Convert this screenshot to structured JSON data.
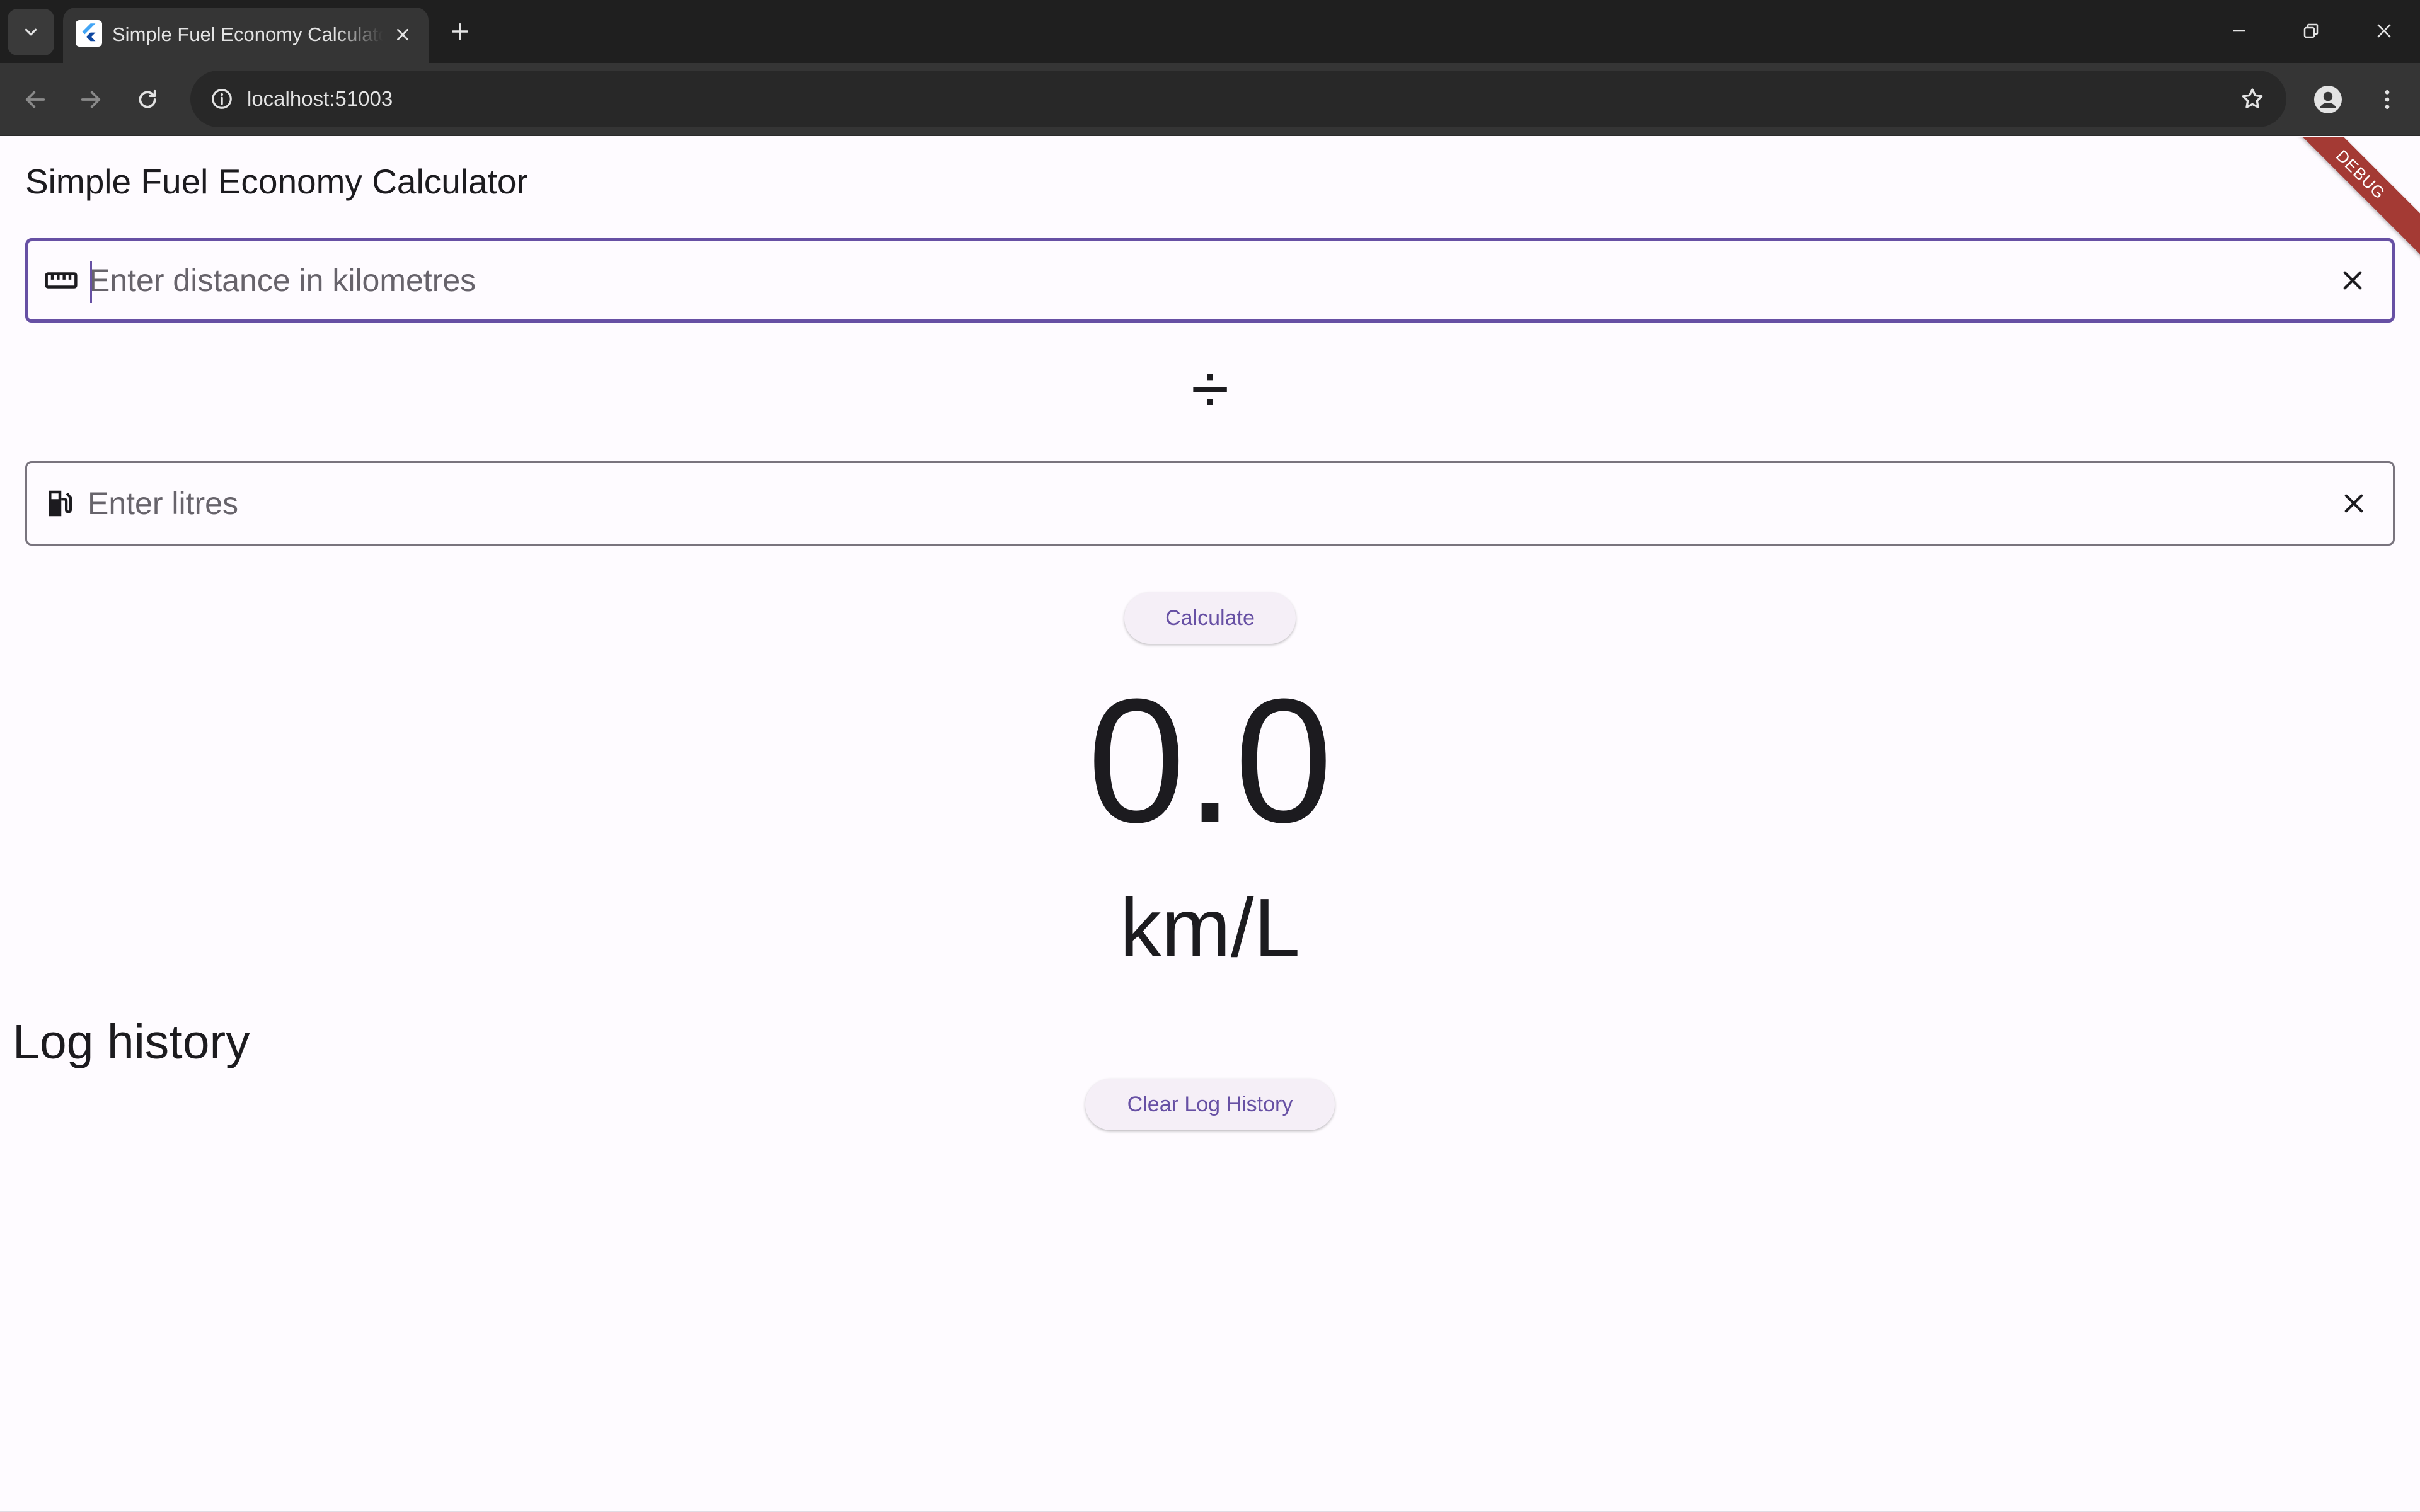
{
  "browser": {
    "tab_title": "Simple Fuel Economy Calculator",
    "url": "localhost:51003"
  },
  "app": {
    "title": "Simple Fuel Economy Calculator",
    "debug_banner": "DEBUG",
    "distance_field": {
      "placeholder": "Enter distance in kilometres",
      "value": "",
      "icon": "ruler-icon"
    },
    "operator_symbol": "÷",
    "litres_field": {
      "placeholder": "Enter litres",
      "value": "",
      "icon": "fuel-pump-icon"
    },
    "calculate_label": "Calculate",
    "result_value": "0.0",
    "result_unit": "km/L",
    "log_heading": "Log history",
    "clear_log_label": "Clear Log History"
  },
  "colors": {
    "primary": "#6750a4",
    "surface": "#fefbff",
    "button_bg": "#f5eff7",
    "on_surface": "#1c1b1f",
    "outline": "#79747e",
    "chrome_dark": "#1f1f1f",
    "chrome_toolbar": "#353535",
    "debug_banner": "#a43a34"
  }
}
